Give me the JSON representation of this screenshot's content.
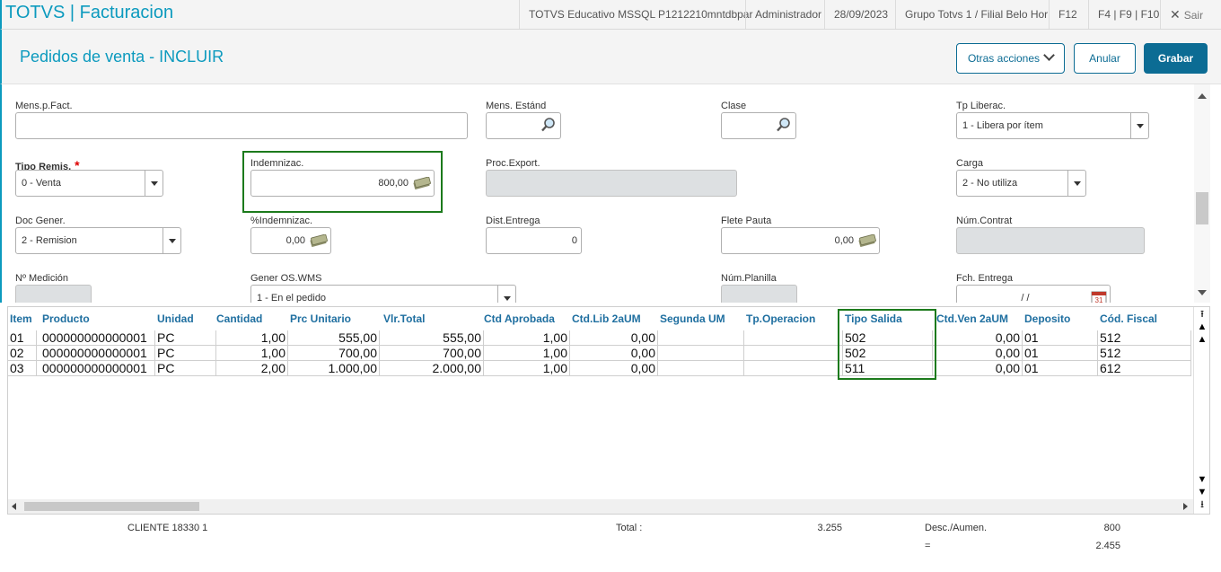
{
  "header": {
    "app_title": "TOTVS | Facturacion",
    "environment": "TOTVS Educativo MSSQL P1212210mntdbpar",
    "user": "Administrador",
    "date": "28/09/2023",
    "branch": "Grupo Totvs 1 / Filial Belo Hor",
    "shortcut_f12": "F12",
    "shortcuts": "F4 | F9 | F10",
    "exit_label": "Sair"
  },
  "page": {
    "title": "Pedidos de venta - INCLUIR",
    "actions": {
      "more_label": "Otras acciones",
      "cancel_label": "Anular",
      "save_label": "Grabar"
    }
  },
  "form": {
    "mens_fact": {
      "label": "Mens.p.Fact.",
      "value": ""
    },
    "mens_estandar": {
      "label": "Mens. Estánd",
      "value": ""
    },
    "clase": {
      "label": "Clase",
      "value": ""
    },
    "tp_liberac": {
      "label": "Tp Liberac.",
      "value": "1 - Libera por ítem"
    },
    "tipo_remis": {
      "label": "Tipo Remis.",
      "required_mark": "*",
      "value": "0 - Venta"
    },
    "indemnizac": {
      "label": "Indemnizac.",
      "value": "800,00"
    },
    "proc_export": {
      "label": "Proc.Export.",
      "value": ""
    },
    "carga": {
      "label": "Carga",
      "value": "2 - No utiliza"
    },
    "doc_gener": {
      "label": "Doc Gener.",
      "value": "2 - Remision"
    },
    "pct_indemnizac": {
      "label": "%Indemnizac.",
      "value": "0,00"
    },
    "dist_entrega": {
      "label": "Dist.Entrega",
      "value": "0"
    },
    "flete_pauta": {
      "label": "Flete Pauta",
      "value": "0,00"
    },
    "num_contrat": {
      "label": "Núm.Contrat",
      "value": ""
    },
    "n_medicion": {
      "label": "Nº Medición",
      "value": ""
    },
    "gener_os_wms": {
      "label": "Gener OS.WMS",
      "value": "1 - En el pedido"
    },
    "num_planilla": {
      "label": "Núm.Planilla",
      "value": ""
    },
    "fch_entrega": {
      "label": "Fch. Entrega",
      "value": "/ /"
    }
  },
  "grid": {
    "columns": [
      "Item",
      "Producto",
      "Unidad",
      "Cantidad",
      "Prc Unitario",
      "Vlr.Total",
      "Ctd Aprobada",
      "Ctd.Lib 2aUM",
      "Segunda UM",
      "Tp.Operacion",
      "Tipo Salida",
      "Ctd.Ven 2aUM",
      "Deposito",
      "Cód. Fiscal"
    ],
    "rows": [
      [
        "01",
        "000000000000001",
        "PC",
        "1,00",
        "555,00",
        "555,00",
        "1,00",
        "0,00",
        "",
        "",
        "502",
        "0,00",
        "01",
        "512"
      ],
      [
        "02",
        "000000000000001",
        "PC",
        "1,00",
        "700,00",
        "700,00",
        "1,00",
        "0,00",
        "",
        "",
        "502",
        "0,00",
        "01",
        "512"
      ],
      [
        "03",
        "000000000000001",
        "PC",
        "2,00",
        "1.000,00",
        "2.000,00",
        "1,00",
        "0,00",
        "",
        "",
        "511",
        "0,00",
        "01",
        "612"
      ]
    ]
  },
  "footer": {
    "client": "CLIENTE 18330 1",
    "total_label": "Total :",
    "total_value": "3.255",
    "desc_label": "Desc./Aumen.",
    "desc_value": "800",
    "equals_label": "=",
    "net_value": "2.455"
  },
  "icons": [
    "search-icon",
    "money-icon",
    "calendar-icon",
    "dropdown-arrow-icon",
    "close-icon",
    "chevron-down-icon"
  ],
  "colors": {
    "brand": "#0c9abe",
    "primary_button": "#0c6c94",
    "highlight": "#1c7a1c",
    "required": "#dd0000"
  }
}
